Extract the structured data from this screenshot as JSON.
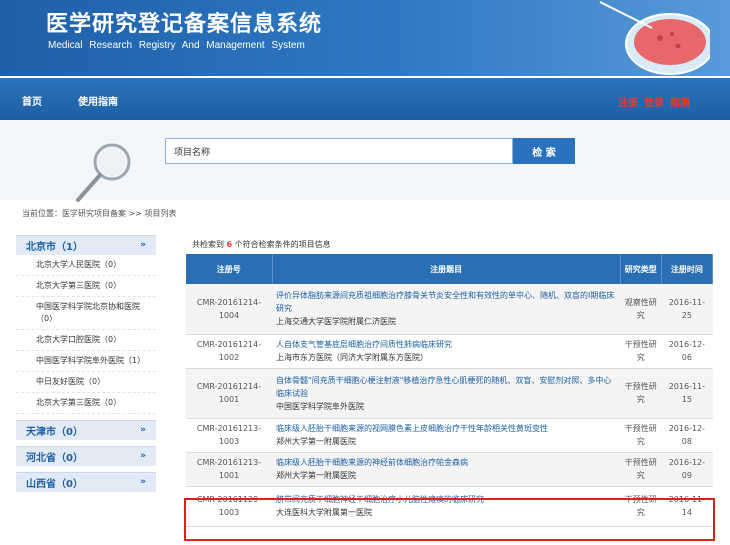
{
  "header": {
    "title": "医学研究登记备案信息系统",
    "subtitle": "Medical Research Registry And Management System"
  },
  "nav": {
    "home": "首页",
    "guide": "使用指南",
    "register": "注册",
    "login": "登录",
    "help": "指南"
  },
  "search": {
    "value": "项目名称",
    "button": "检 索"
  },
  "breadcrumb": "当前位置：医学研究项目备案 >> 项目列表",
  "sidebar": {
    "provinces": [
      {
        "name": "北京市（1）",
        "hospitals": [
          "北京大学人民医院（0）",
          "北京大学第三医院（0）",
          "中国医学科学院北京协和医院（0）",
          "北京大学口腔医院（0）",
          "中国医学科学院阜外医院（1）",
          "中日友好医院（0）",
          "北京大学第三医院（0）"
        ]
      },
      {
        "name": "天津市（0）"
      },
      {
        "name": "河北省（0）"
      },
      {
        "name": "山西省（0）"
      }
    ]
  },
  "results": {
    "summary_prefix": "共检索到",
    "count": "6",
    "summary_suffix": "个符合检索条件的项目信息",
    "headers": {
      "reg": "注册号",
      "topic": "注册题目",
      "type": "研究类型",
      "date": "注册时间"
    },
    "rows": [
      {
        "reg": "CMR-20161214-1004",
        "title": "评价异体脂肪来源间充质祖细胞治疗膝骨关节炎安全性和有效性的单中心、随机、双盲的Ⅰ期临床研究",
        "inst": "上海交通大学医学院附属仁济医院",
        "type": "观察性研究",
        "date": "2016-11-25"
      },
      {
        "reg": "CMR-20161214-1002",
        "title": "人自体支气管基底层细胞治疗间质性肺病临床研究",
        "inst": "上海市东方医院（同济大学附属东方医院）",
        "type": "干预性研究",
        "date": "2016-12-06"
      },
      {
        "reg": "CMR-20161214-1001",
        "title": "自体骨髓\"间充质干细胞心梗注射液\"移植治疗急性心肌梗死的随机、双盲、安慰剂对照、多中心临床试验",
        "inst": "中国医学科学院阜外医院",
        "type": "干预性研究",
        "date": "2016-11-15"
      },
      {
        "reg": "CMR-20161213-1003",
        "title": "临床级人胚胎干细胞来源的视网膜色素上皮细胞治疗干性年龄相关性黄斑变性",
        "inst": "郑州大学第一附属医院",
        "type": "干预性研究",
        "date": "2016-12-08"
      },
      {
        "reg": "CMR-20161213-1001",
        "title": "临床级人胚胎干细胞来源的神经前体细胞治疗帕金森病",
        "inst": "郑州大学第一附属医院",
        "type": "干预性研究",
        "date": "2016-12-09"
      },
      {
        "reg": "CMR-20161129-1003",
        "title": "脐带间充质干细胞神经干细胞治疗小儿脑性瘫痪的临床研究",
        "inst": "大连医科大学附属第一医院",
        "type": "干预性研究",
        "date": "2016-11-14"
      }
    ]
  },
  "colors": {
    "brand_blue": "#1d5fa3",
    "accent_red": "#e63a2f",
    "highlight_red": "#e01f1f"
  }
}
